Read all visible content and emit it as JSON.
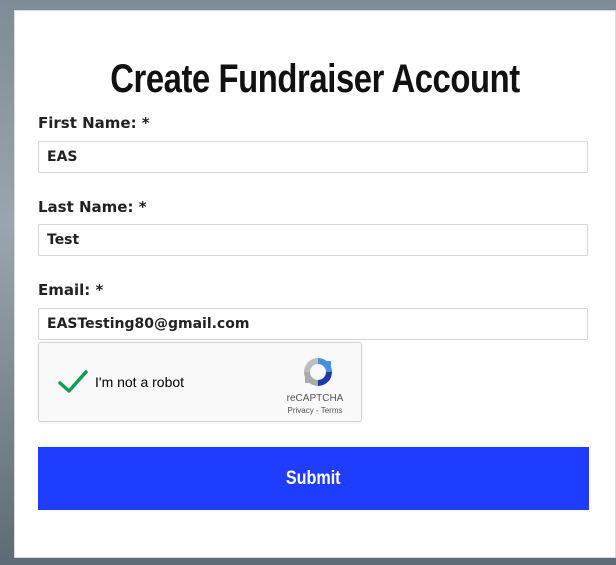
{
  "form": {
    "title": "Create Fundraiser Account",
    "first_name_label": "First Name: *",
    "first_name_value": "EAS",
    "last_name_label": "Last Name: *",
    "last_name_value": "Test",
    "email_label": "Email: *",
    "email_value": "EASTesting80@gmail.com",
    "submit_label": "Submit"
  },
  "captcha": {
    "checkbox_label": "I'm not a robot",
    "checked": true,
    "brand": "reCAPTCHA",
    "privacy_link": "Privacy",
    "separator": " - ",
    "terms_link": "Terms",
    "check_icon": "checkmark-icon",
    "logo_icon": "recaptcha-logo-icon"
  },
  "colors": {
    "submit_bg": "#1f3dff",
    "check_green": "#0f9d58"
  }
}
